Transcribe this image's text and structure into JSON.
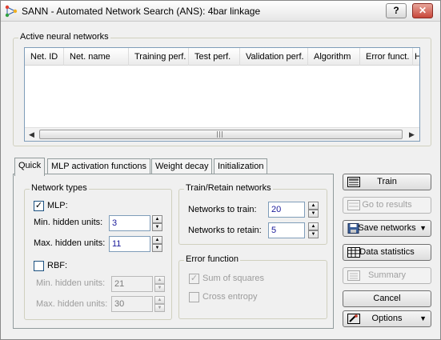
{
  "window": {
    "title": "SANN - Automated Network Search (ANS): 4bar linkage",
    "help_label": "?",
    "close_label": "✕"
  },
  "networks_group": {
    "label": "Active neural networks",
    "columns": [
      "Net. ID",
      "Net. name",
      "Training perf.",
      "Test perf.",
      "Validation perf.",
      "Algorithm",
      "Error funct.",
      "H"
    ],
    "scroll_left": "◀",
    "scroll_right": "▶"
  },
  "tabs": [
    {
      "label": "Quick",
      "active": true
    },
    {
      "label": "MLP activation functions",
      "active": false
    },
    {
      "label": "Weight decay",
      "active": false
    },
    {
      "label": "Initialization",
      "active": false
    }
  ],
  "network_types": {
    "label": "Network types",
    "mlp": {
      "label": "MLP:",
      "checked": "✓"
    },
    "mlp_min": {
      "label": "Min. hidden units:",
      "value": "3"
    },
    "mlp_max": {
      "label": "Max. hidden units:",
      "value": "11"
    },
    "rbf": {
      "label": "RBF:",
      "checked": ""
    },
    "rbf_min": {
      "label": "Min. hidden units:",
      "value": "21"
    },
    "rbf_max": {
      "label": "Max. hidden units:",
      "value": "30"
    }
  },
  "train_retain": {
    "label": "Train/Retain networks",
    "to_train": {
      "label": "Networks to train:",
      "value": "20"
    },
    "to_retain": {
      "label": "Networks to retain:",
      "value": "5"
    }
  },
  "error_function": {
    "label": "Error function",
    "sum_of_squares": {
      "label": "Sum of squares",
      "checked": "✓"
    },
    "cross_entropy": {
      "label": "Cross entropy",
      "checked": ""
    }
  },
  "spinner": {
    "up": "▲",
    "down": "▼"
  },
  "buttons": {
    "train": "Train",
    "go_to_results": "Go to results",
    "save_networks": "Save networks",
    "data_statistics": "Data statistics",
    "summary": "Summary",
    "cancel": "Cancel",
    "options": "Options",
    "dropdown_arrow": "▼"
  },
  "colors": {
    "window_bg": "#f0f0f0",
    "input_border": "#7f9db9",
    "value_text": "#1a1a9a"
  }
}
